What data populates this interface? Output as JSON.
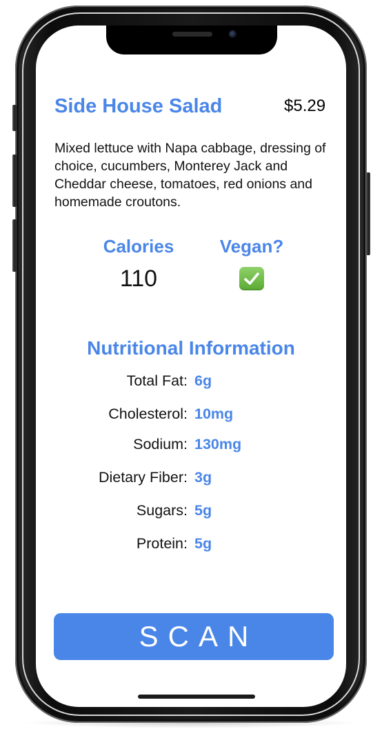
{
  "item": {
    "name": "Side House Salad",
    "price": "$5.29",
    "description": "Mixed lettuce with Napa cabbage, dressing of choice, cucumbers, Monterey Jack and Cheddar cheese, tomatoes, red onions and homemade croutons."
  },
  "stats": {
    "calories_label": "Calories",
    "calories_value": "110",
    "vegan_label": "Vegan?",
    "vegan_value": true
  },
  "nutrition": {
    "heading": "Nutritional Information",
    "rows": [
      {
        "label": "Total Fat:",
        "value": "6g"
      },
      {
        "label": "Cholesterol:",
        "value": "10mg"
      },
      {
        "label": "Sodium:",
        "value": "130mg"
      },
      {
        "label": "Dietary Fiber:",
        "value": "3g"
      },
      {
        "label": "Sugars:",
        "value": "5g"
      },
      {
        "label": "Protein:",
        "value": "5g"
      }
    ]
  },
  "actions": {
    "scan_label": "SCAN"
  },
  "colors": {
    "accent": "#4a86e8",
    "check_green": "#6cbf45"
  },
  "icons": {
    "vegan_indicator": "check-mark-button-icon"
  }
}
